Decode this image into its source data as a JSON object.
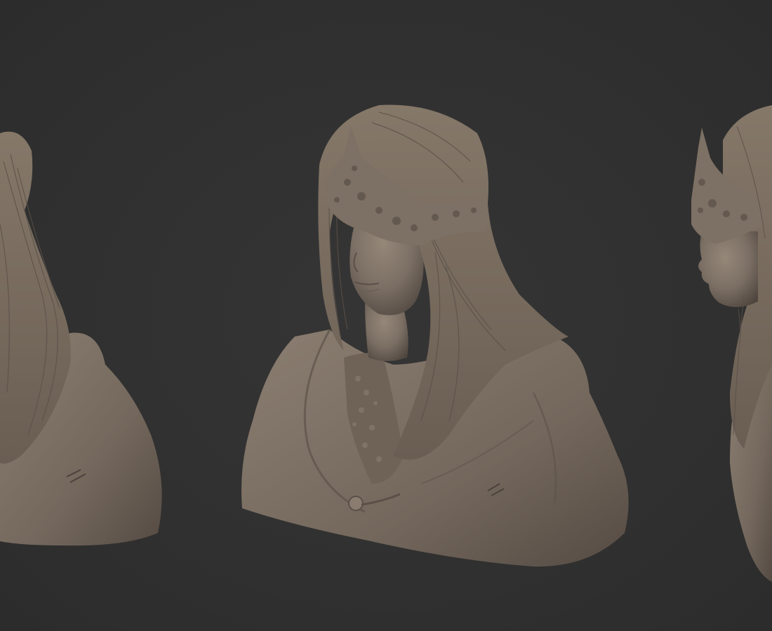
{
  "scene": {
    "background_color": "#303030",
    "clay_color": "#7a6e64",
    "clay_shadow_color": "#4a423c",
    "clay_highlight_color": "#9a8d80",
    "views": [
      {
        "id": "left",
        "description_name": "bust-view-back-left"
      },
      {
        "id": "center",
        "description_name": "bust-view-front-three-quarter"
      },
      {
        "id": "right",
        "description_name": "bust-view-side-profile"
      }
    ]
  }
}
